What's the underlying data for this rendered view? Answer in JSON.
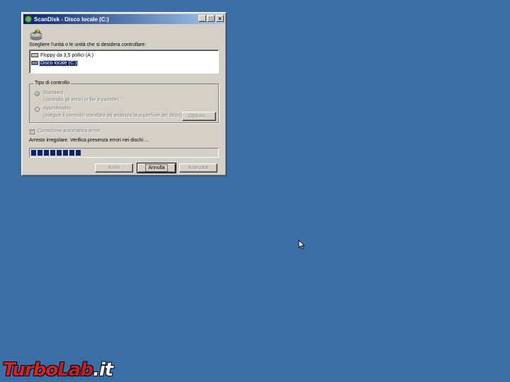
{
  "window": {
    "title": "ScanDisk - Disco locale (C:)",
    "controls": {
      "minimize": "_",
      "maximize": "□",
      "close": "×"
    }
  },
  "main": {
    "select_label": "Scegliere l'unità o le unità che si desidera controllare:",
    "drives": [
      {
        "label": "Floppy da 3,5 pollici (A:)",
        "icon": "floppy-drive-icon",
        "selected": false
      },
      {
        "label": "Disco locale (C:)",
        "icon": "hard-disk-icon",
        "selected": true
      }
    ],
    "check_type": {
      "group_title": "Tipo di controllo",
      "standard_label": "Standard",
      "standard_desc": "(controlla gli errori in file e cartelle)",
      "thorough_label": "Approfondito",
      "thorough_desc": "(esegue il controllo standard ed analizza la superficie del disco)",
      "options_button": "Opzioni...",
      "selected": "standard"
    },
    "auto_fix_label": "Correzione automatica errori",
    "auto_fix_checked": true,
    "status_text": "Arresto irregolare. Verifica presenza errori nei dischi ...",
    "progress_blocks": 8
  },
  "buttons": {
    "start": "Avvio",
    "cancel": "Annulla",
    "advanced": "Avanzate"
  },
  "watermark": {
    "part1": "Turbo",
    "part2": "Lab",
    "part3": ".it"
  },
  "colors": {
    "desktop": "#3a6ea5",
    "titlebar_start": "#0a246a",
    "titlebar_end": "#a6caf0",
    "progress": "#0a246a",
    "watermark": "#e02020"
  }
}
